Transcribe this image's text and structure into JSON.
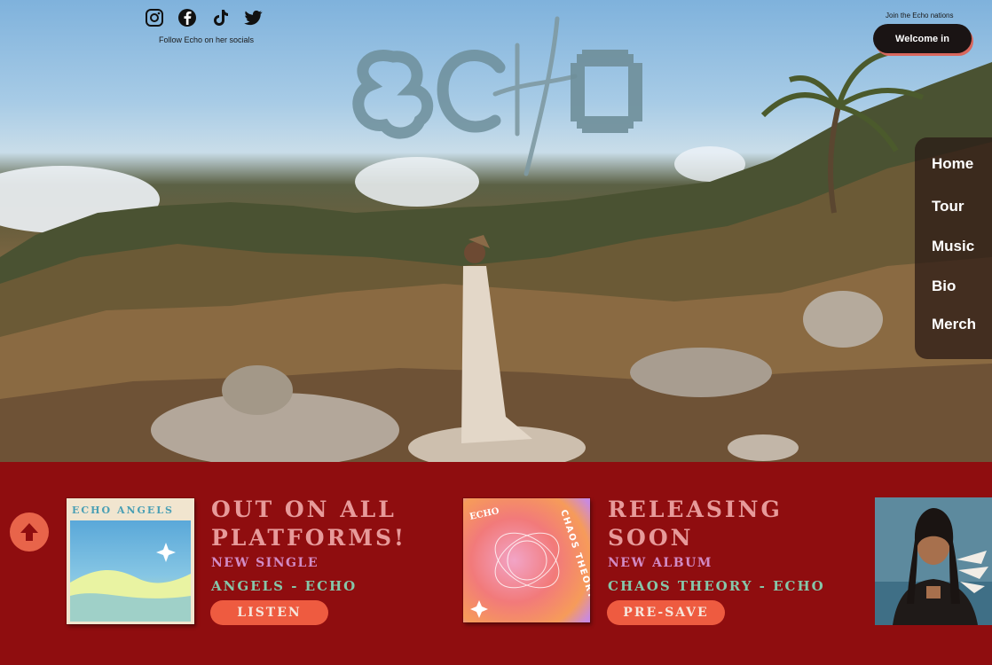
{
  "socials": {
    "caption": "Follow Echo on her socials",
    "icons": [
      "instagram-icon",
      "facebook-icon",
      "tiktok-icon",
      "twitter-icon"
    ]
  },
  "logo": {
    "text": "ECHO"
  },
  "join": {
    "caption": "Join the Echo nations",
    "button_label": "Welcome in"
  },
  "nav": {
    "items": [
      "Home",
      "Tour",
      "Music",
      "Bio",
      "Merch"
    ]
  },
  "releases": [
    {
      "headline_line1": "OUT ON ALL",
      "headline_line2": "PLATFORMS!",
      "kicker": "NEW SINGLE",
      "track": "ANGELS - ECHO",
      "cta": "LISTEN",
      "cover_text": "ECHO ANGELS"
    },
    {
      "headline_line1": "RELEASING",
      "headline_line2": "SOON",
      "kicker": "NEW ALBUM",
      "track": "CHAOS THEORY - ECHO",
      "cta": "PRE-SAVE",
      "cover_text_echo": "ECHO",
      "cover_text_title": "CHAOS THEORY"
    }
  ],
  "colors": {
    "band": "#8f0d0f",
    "headline": "#e79a9a",
    "kicker": "#d28bc5",
    "track": "#86c6a9",
    "cta": "#ee5b40",
    "back_to_top": "#e8644a"
  }
}
